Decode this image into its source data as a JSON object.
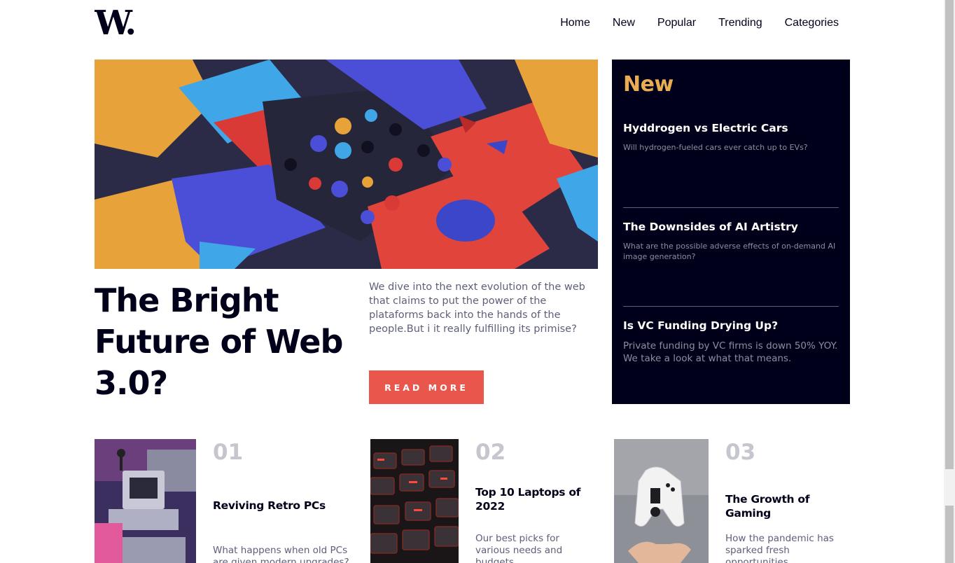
{
  "header": {
    "logo_text": "W.",
    "nav": [
      "Home",
      "New",
      "Popular",
      "Trending",
      "Categories"
    ]
  },
  "hero": {
    "image_icon": "abstract-3d-blocks-image",
    "title": "The Bright Future of Web 3.0?",
    "description": "We dive into the next evolution of the web that claims to put the power of the plataforms back into the hands of the people.But i it really fulfilling its primise?",
    "button_label": "READ MORE"
  },
  "new_panel": {
    "heading": "New",
    "items": [
      {
        "title": "Hyddrogen vs Electric Cars",
        "description": "Will hydrogen-fueled cars ever catch up to EVs?"
      },
      {
        "title": "The Downsides of AI Artistry",
        "description": "What are the possible adverse effects of on-demand AI image generation?"
      },
      {
        "title": "Is VC Funding Drying Up?",
        "description": "Private funding by VC firms is down 50% YOY. We take a look at what that means."
      }
    ]
  },
  "cards": [
    {
      "number": "01",
      "title": "Reviving Retro PCs",
      "description": "What happens when old PCs are given modern upgrades?",
      "image_icon": "retro-pc-image"
    },
    {
      "number": "02",
      "title": "Top 10 Laptops of 2022",
      "description": "Our best picks for various needs and budgets.",
      "image_icon": "keyboard-image"
    },
    {
      "number": "03",
      "title": "The Growth of Gaming",
      "description": "How the pandemic has sparked fresh opportunities.",
      "image_icon": "game-controller-image"
    }
  ],
  "colors": {
    "dark": "#00001a",
    "accent_red": "#e9564b",
    "accent_orange": "#e9ab53",
    "grey": "#5d5f79"
  }
}
